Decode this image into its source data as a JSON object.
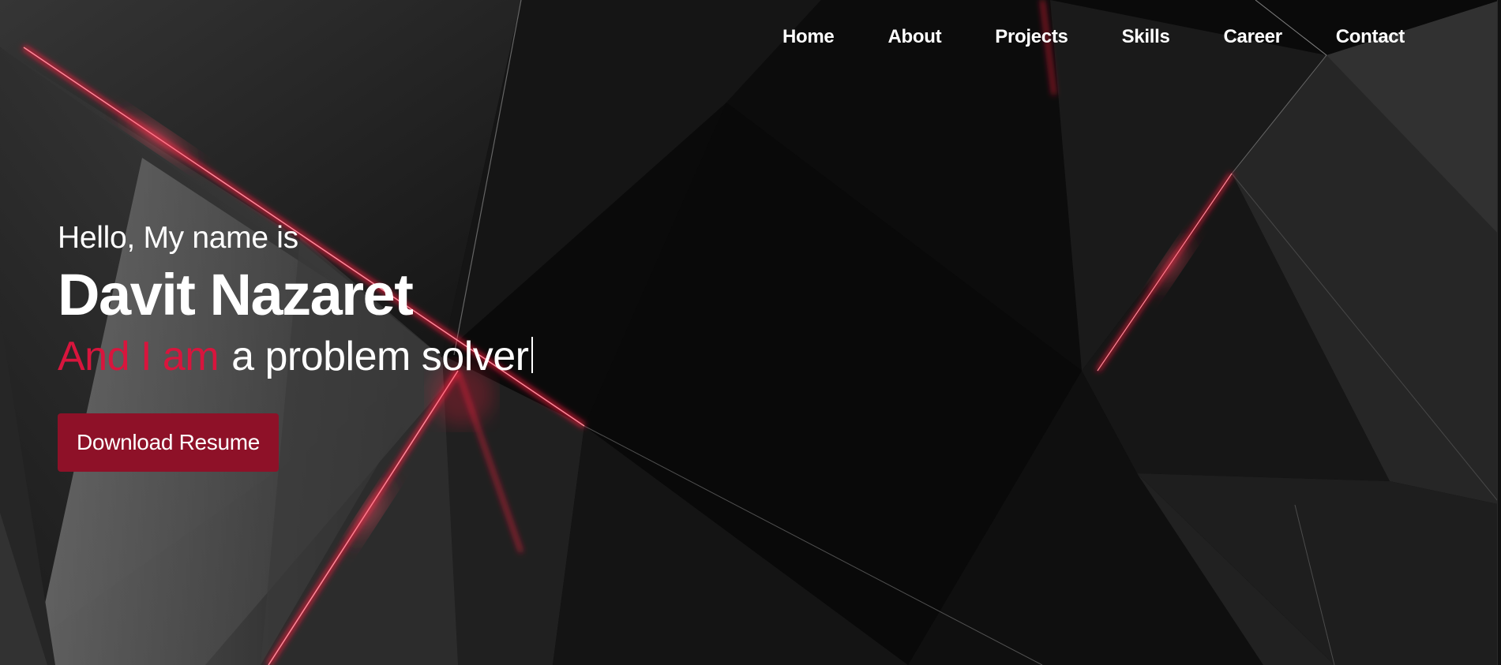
{
  "nav": {
    "items": [
      {
        "label": "Home"
      },
      {
        "label": "About"
      },
      {
        "label": "Projects"
      },
      {
        "label": "Skills"
      },
      {
        "label": "Career"
      },
      {
        "label": "Contact"
      }
    ]
  },
  "hero": {
    "greeting": "Hello, My name is",
    "name": "Davit Nazaret",
    "tagline_prefix": "And I am",
    "tagline_role": "a problem solver",
    "cta_label": "Download Resume"
  },
  "colors": {
    "accent": "#d8153d",
    "button": "#8e1128",
    "background": "#0b0b0b",
    "text": "#ffffff"
  }
}
